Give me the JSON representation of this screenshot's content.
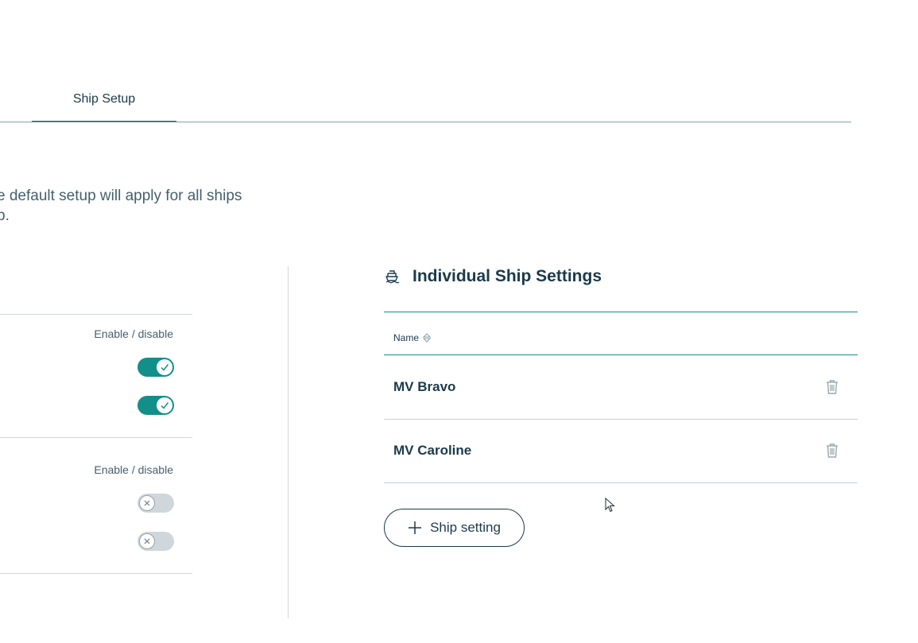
{
  "tabs": {
    "active_label": "Ship Setup"
  },
  "description": {
    "line1": "e default setup will apply for all ships",
    "line2": "p."
  },
  "default_setup": {
    "groups": [
      {
        "column_label": "Enable / disable",
        "toggles": [
          {
            "state": "on"
          },
          {
            "state": "on"
          }
        ]
      },
      {
        "column_label": "Enable / disable",
        "toggles": [
          {
            "state": "off"
          },
          {
            "state": "off"
          }
        ]
      }
    ]
  },
  "individual": {
    "title": "Individual Ship Settings",
    "icon": "ship-icon",
    "column_name": "Name",
    "rows": [
      {
        "name": "MV Bravo"
      },
      {
        "name": "MV Caroline"
      }
    ],
    "add_button_label": "Ship setting"
  },
  "colors": {
    "accent": "#138f8a",
    "text": "#1b3a4b",
    "toggle_off": "#d0d7dc"
  }
}
